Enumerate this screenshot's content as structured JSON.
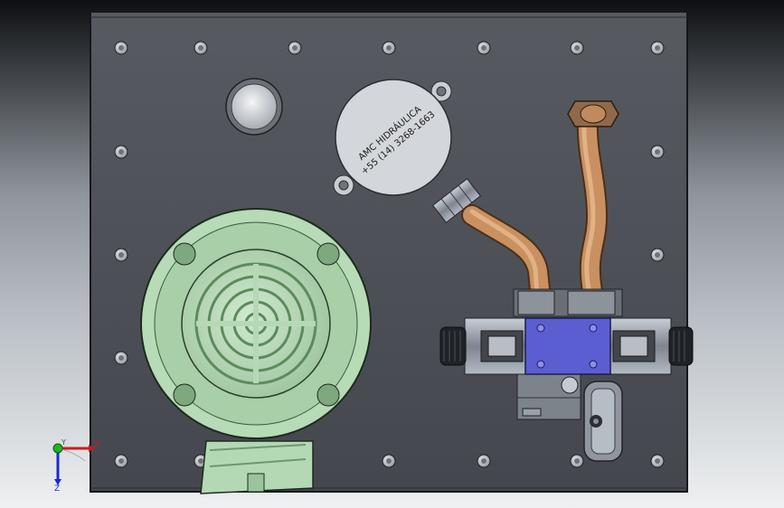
{
  "reservoir": {
    "label_line1": "AMC HIDRÁULICA",
    "label_line2": "+55 (14) 3268-1663"
  },
  "triad": {
    "x_label": "X",
    "y_label": "Y",
    "z_label": "Z"
  },
  "colors": {
    "plate": "#4b4f55",
    "motor": "#b9dcb9",
    "motor_dark": "#7fa67f",
    "pipe": "#c58a57",
    "valve_block": "#5b5ed0",
    "steel": "#9da4ad"
  }
}
